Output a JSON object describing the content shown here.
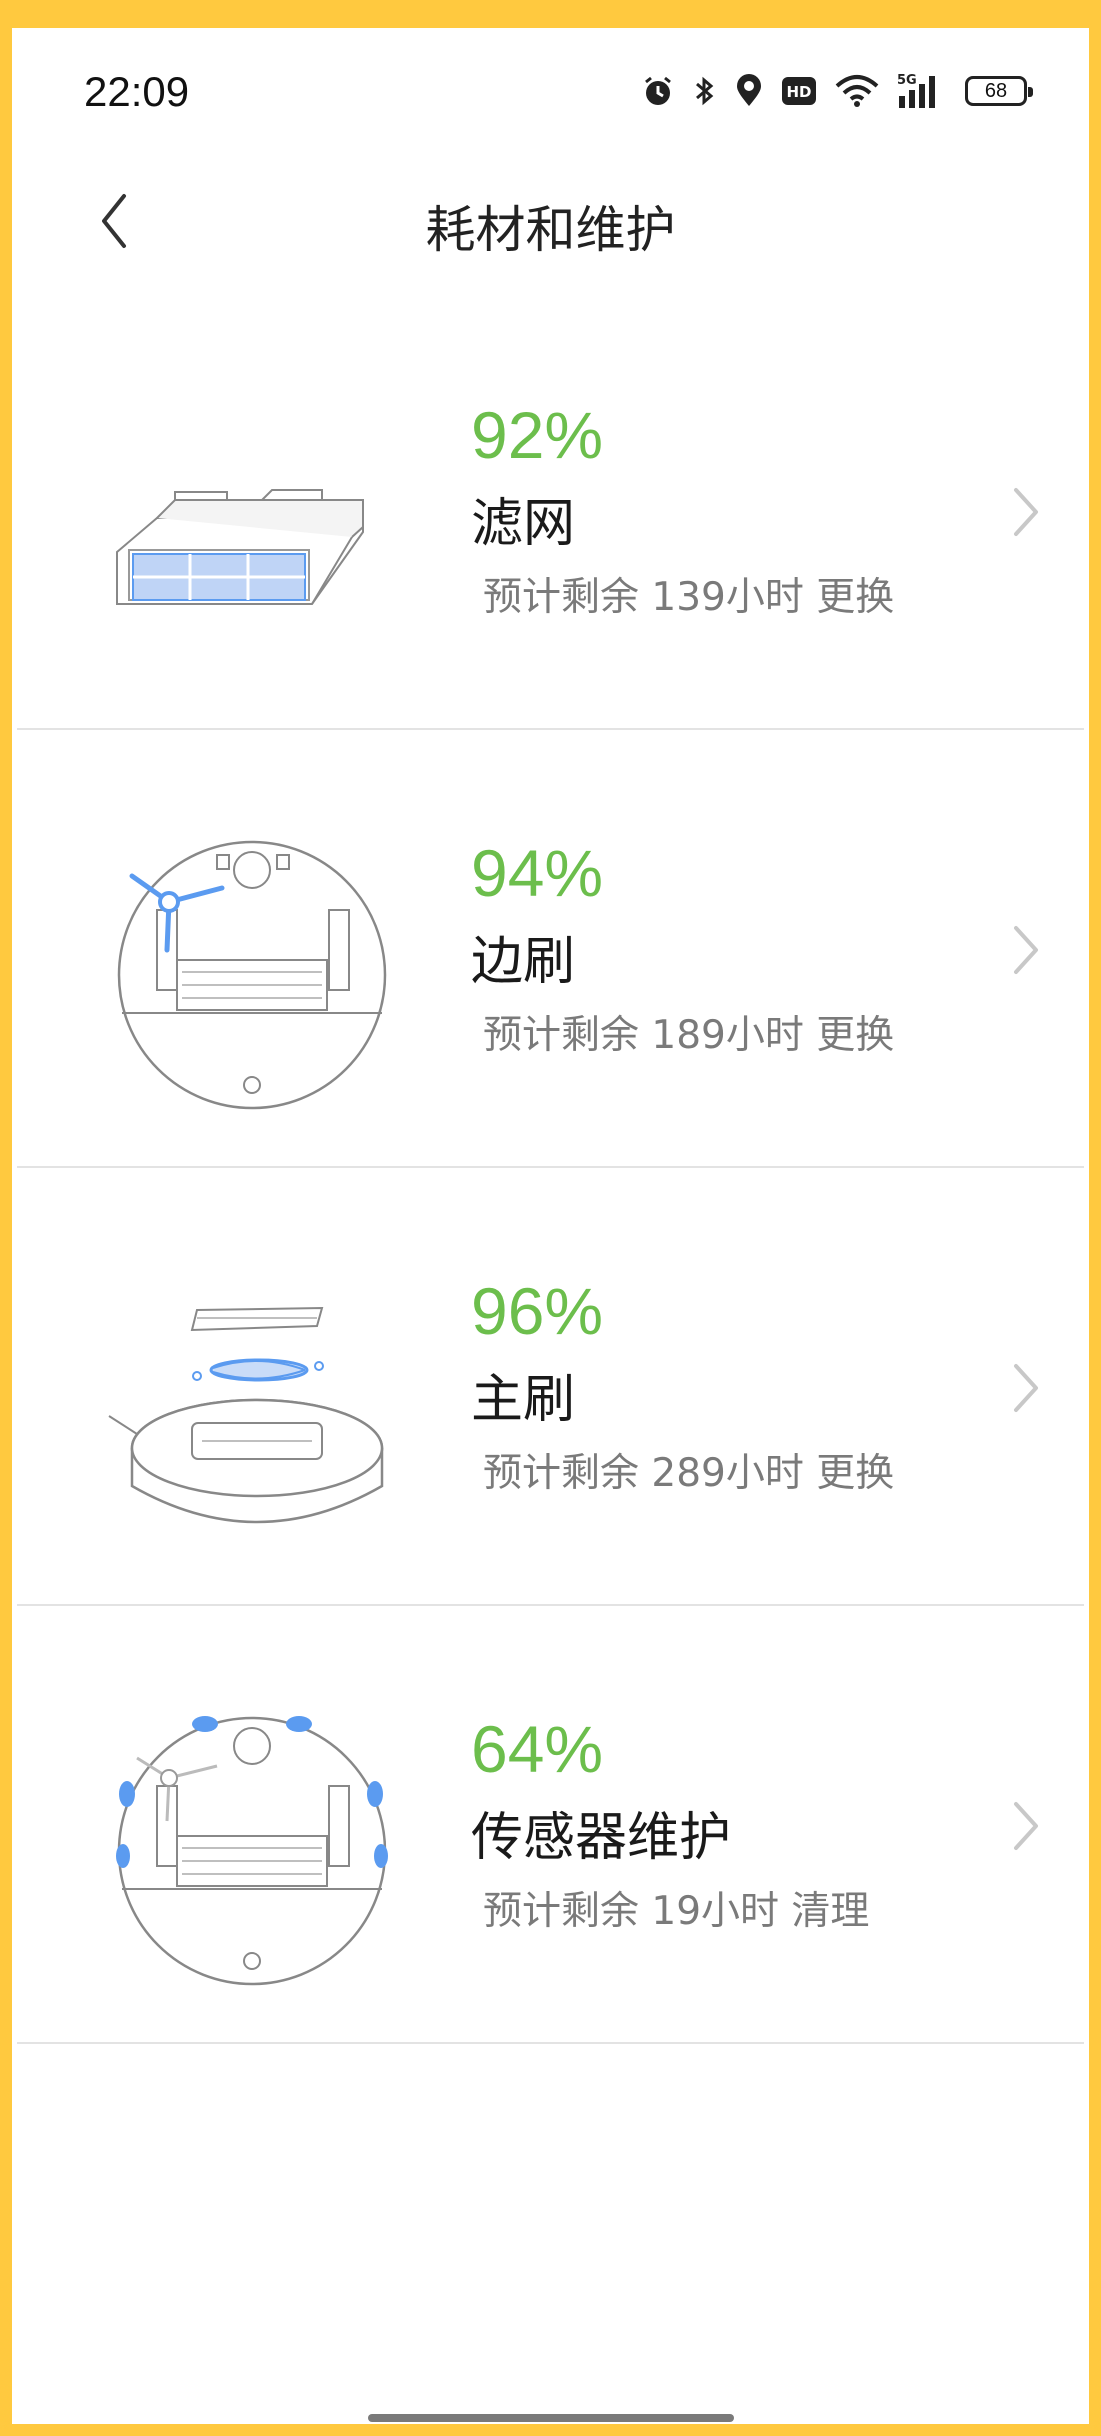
{
  "status_bar": {
    "time": "22:09",
    "battery_level": "68",
    "network": "5G",
    "icons": [
      "alarm-icon",
      "bluetooth-icon",
      "location-icon",
      "hd-icon",
      "wifi-icon",
      "signal-icon",
      "battery-icon"
    ]
  },
  "header": {
    "title": "耗材和维护",
    "back_icon": "chevron-left-icon"
  },
  "colors": {
    "percent_green": "#6CBE4C",
    "accent_blue": "#5B9BF0",
    "frame": "#FFC93F"
  },
  "consumables": [
    {
      "percent": "92%",
      "name": "滤网",
      "remaining": "预计剩余 139小时 更换",
      "icon": "filter-icon"
    },
    {
      "percent": "94%",
      "name": "边刷",
      "remaining": "预计剩余 189小时 更换",
      "icon": "side-brush-icon"
    },
    {
      "percent": "96%",
      "name": "主刷",
      "remaining": "预计剩余 289小时 更换",
      "icon": "main-brush-icon"
    },
    {
      "percent": "64%",
      "name": "传感器维护",
      "remaining": "预计剩余 19小时 清理",
      "icon": "sensor-icon"
    }
  ]
}
